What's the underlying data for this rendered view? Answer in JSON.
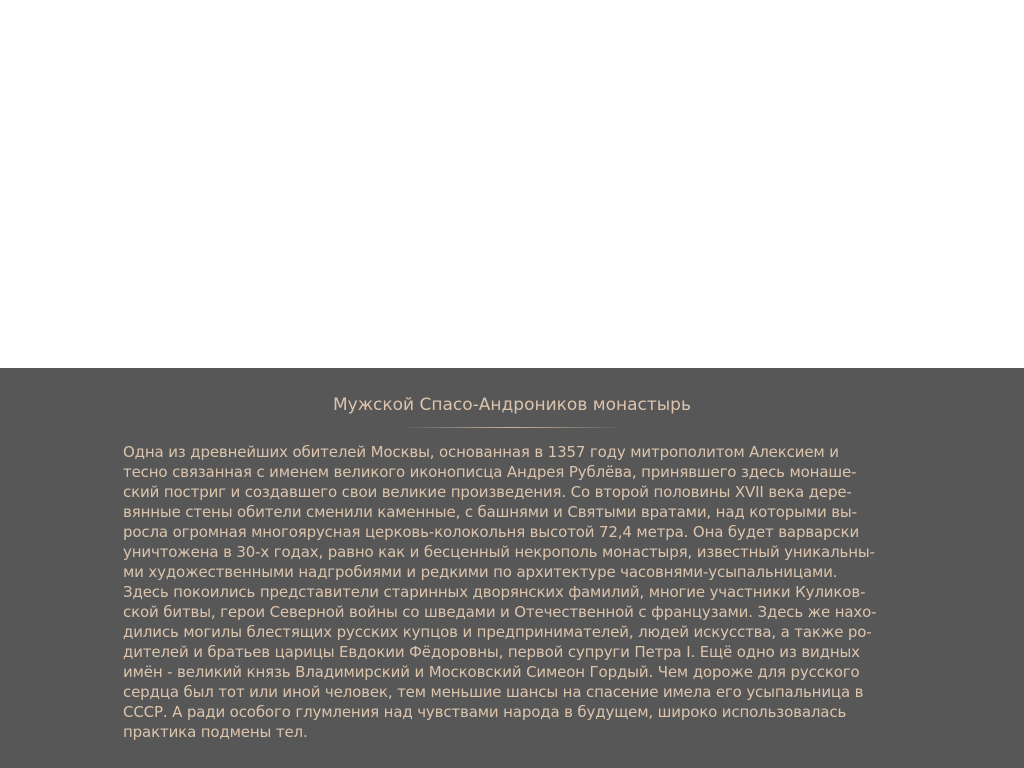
{
  "panel": {
    "title": "Мужской Спасо-Андроников монастырь",
    "body_lines": [
      "Одна из древнейших обителей Москвы, основанная в 1357 году митрополитом Алексием и",
      "тесно связанная с именем великого иконописца Андрея Рублёва, принявшего здесь монаше-",
      "ский постриг и создавшего свои великие произведения. Со второй половины XVII века дере-",
      "вянные стены обители сменили каменные, с башнями и Святыми вратами, над которыми вы-",
      "росла огромная многоярусная церковь-колокольня высотой 72,4 метра. Она будет варварски",
      "уничтожена в 30-х годах, равно как и бесценный некрополь монастыря, известный уникальны-",
      "ми художественными надгробиями и редкими по архитектуре часовнями-усыпальницами.",
      "Здесь покоились представители старинных дворянских фамилий, многие участники Куликов-",
      "ской битвы, герои Северной войны со шведами и Отечественной с французами. Здесь же нахо-",
      "дились могилы блестящих русских купцов и предпринимателей, людей искусства, а также ро-",
      "дителей и братьев царицы Евдокии Фёдоровны, первой супруги Петра I. Ещё одно из видных",
      "имён - великий князь Владимирский и Московский Симеон Гордый. Чем дороже для русского",
      "сердца был тот или иной человек, тем меньшие шансы на спасение имела его усыпальница в",
      "СССР. А ради особого глумления над чувствами народа в будущем, широко использовалась",
      "практика подмены тел."
    ]
  },
  "colors": {
    "panel_background": "#575757",
    "text": "#dcc4ac",
    "page_background": "#ffffff"
  }
}
